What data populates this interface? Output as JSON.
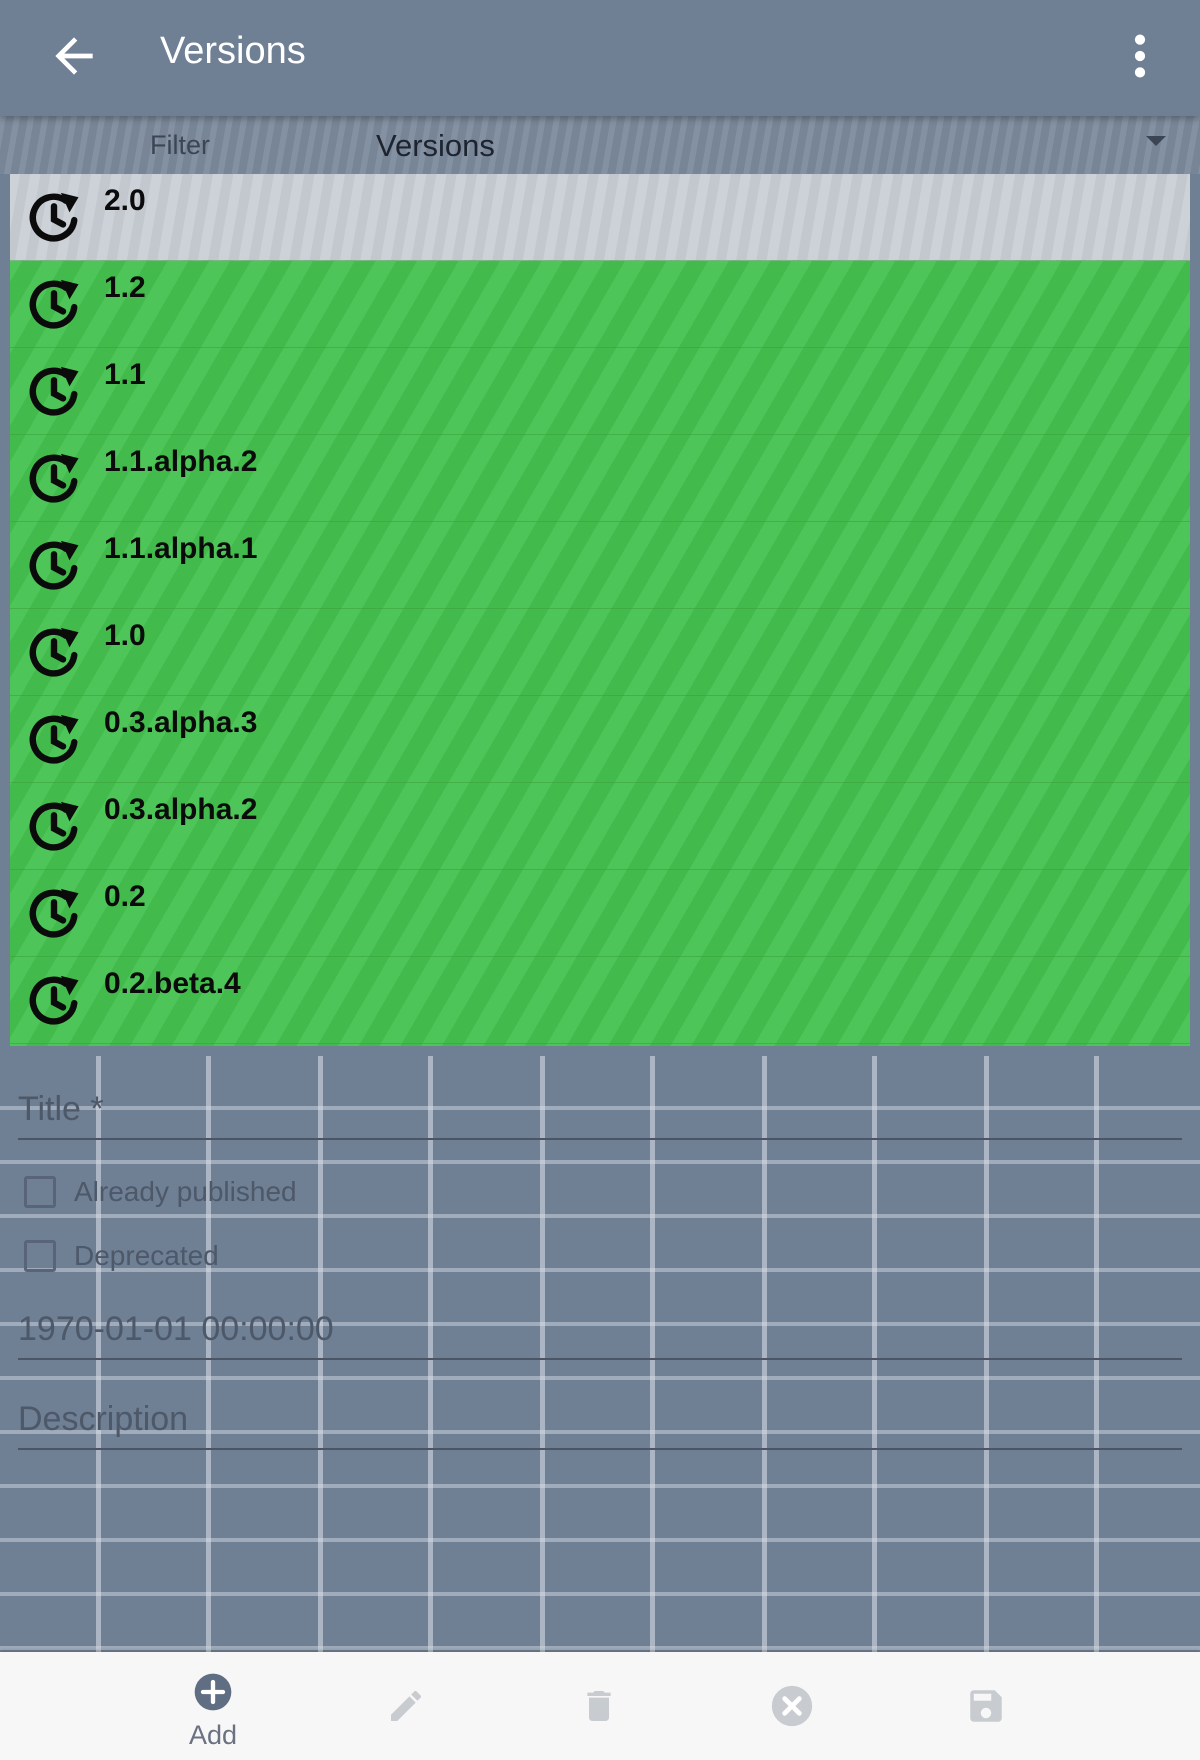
{
  "appbar": {
    "title": "Versions",
    "back_icon": "arrow-left-icon",
    "menu_icon": "more-vertical-icon"
  },
  "filter": {
    "label": "Filter",
    "selected": "Versions"
  },
  "versions": {
    "selected_index": 0,
    "items": [
      {
        "label": "2.0"
      },
      {
        "label": "1.2"
      },
      {
        "label": "1.1"
      },
      {
        "label": "1.1.alpha.2"
      },
      {
        "label": "1.1.alpha.1"
      },
      {
        "label": "1.0"
      },
      {
        "label": "0.3.alpha.3"
      },
      {
        "label": "0.3.alpha.2"
      },
      {
        "label": "0.2"
      },
      {
        "label": "0.2.beta.4"
      }
    ]
  },
  "form": {
    "title_placeholder": "Title *",
    "published_label": "Already published",
    "deprecated_label": "Deprecated",
    "date_value": "1970-01-01 00:00:00",
    "description_placeholder": "Description"
  },
  "bottombar": {
    "add_label": "Add"
  },
  "colors": {
    "appbar": "#6f7f94",
    "list_green": "#45c24f",
    "selected_row": "#c9ced6",
    "bottombar": "#f7f7f7"
  }
}
